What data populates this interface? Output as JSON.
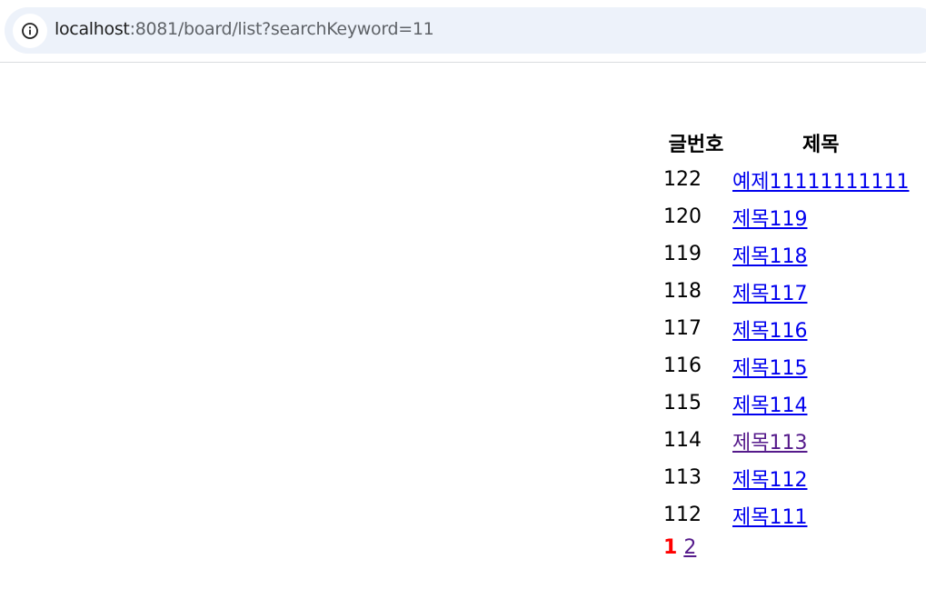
{
  "browser": {
    "url_host": "localhost",
    "url_rest": ":8081/board/list?searchKeyword=11"
  },
  "board": {
    "headers": {
      "number": "글번호",
      "title": "제목"
    },
    "rows": [
      {
        "number": "122",
        "title": "예제11111111111",
        "visited": false
      },
      {
        "number": "120",
        "title": "제목119",
        "visited": false
      },
      {
        "number": "119",
        "title": "제목118",
        "visited": false
      },
      {
        "number": "118",
        "title": "제목117",
        "visited": false
      },
      {
        "number": "117",
        "title": "제목116",
        "visited": false
      },
      {
        "number": "116",
        "title": "제목115",
        "visited": false
      },
      {
        "number": "115",
        "title": "제목114",
        "visited": false
      },
      {
        "number": "114",
        "title": "제목113",
        "visited": true
      },
      {
        "number": "113",
        "title": "제목112",
        "visited": false
      },
      {
        "number": "112",
        "title": "제목111",
        "visited": false
      }
    ]
  },
  "pagination": {
    "current": "1",
    "pages": [
      "2"
    ]
  },
  "colors": {
    "link": "#0000ee",
    "visited_link": "#551a8b",
    "current_page": "#ff0000"
  }
}
